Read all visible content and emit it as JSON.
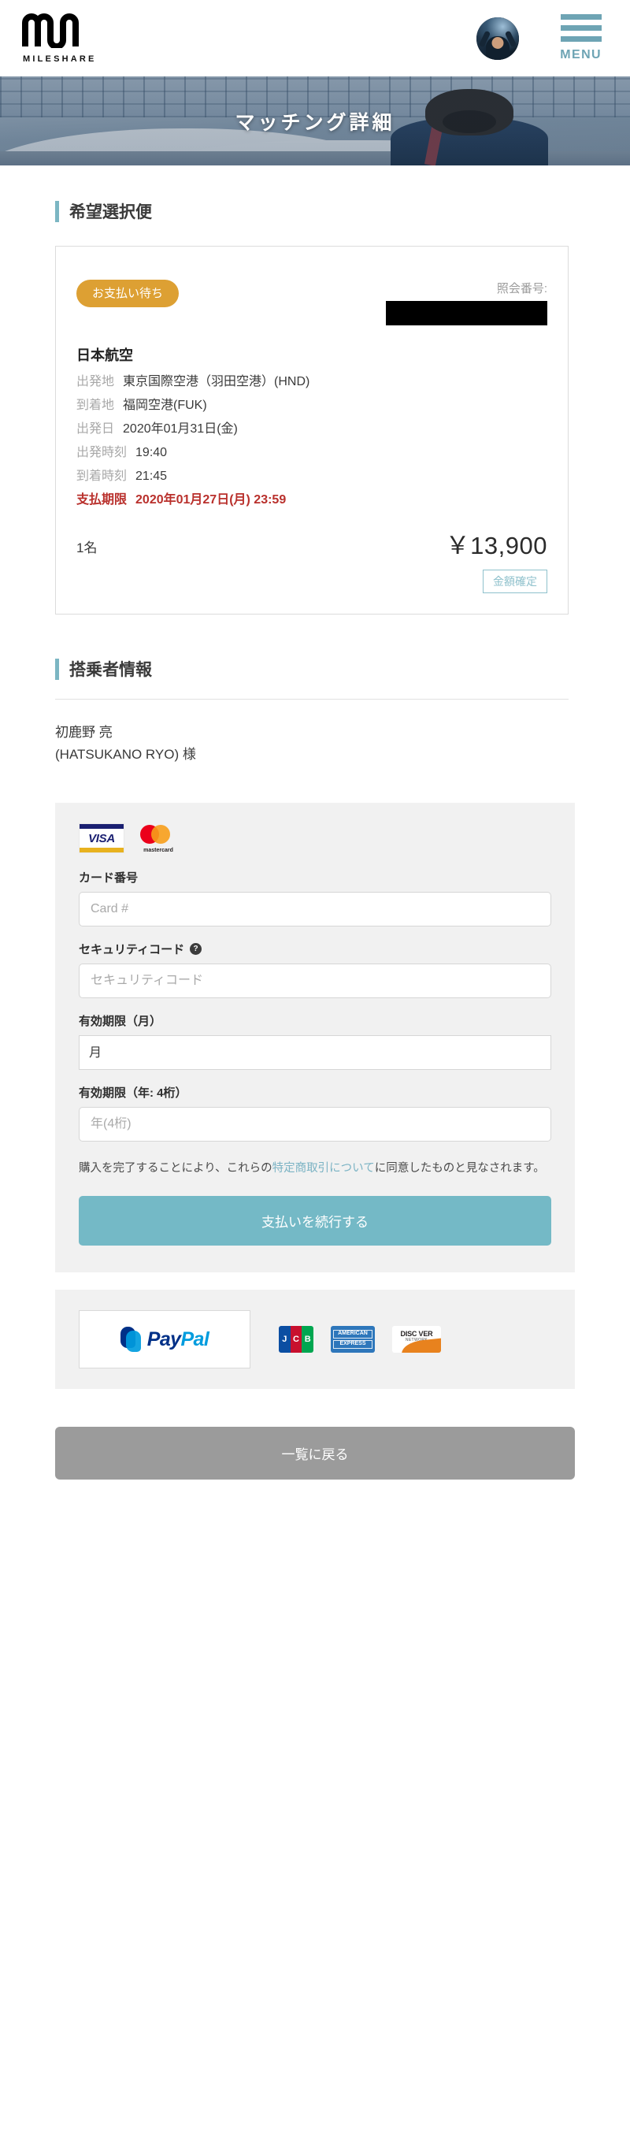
{
  "header": {
    "logo_word": "MILESHARE",
    "logo_icon": "mileshare-wave-logo",
    "avatar_icon": "user-avatar",
    "menu_label": "MENU",
    "menu_icon": "hamburger-menu-icon"
  },
  "hero": {
    "title": "マッチング詳細",
    "image_alt": "airport-flight-attendant"
  },
  "flight_section": {
    "title": "希望選択便",
    "status_badge": "お支払い待ち",
    "reference_label": "照会番号:",
    "reference_value": "",
    "airline": "日本航空",
    "details": [
      {
        "label": "出発地",
        "value": "東京国際空港（羽田空港）(HND)"
      },
      {
        "label": "到着地",
        "value": "福岡空港(FUK)"
      },
      {
        "label": "出発日",
        "value": "2020年01月31日(金)"
      },
      {
        "label": "出発時刻",
        "value": "19:40"
      },
      {
        "label": "到着時刻",
        "value": "21:45"
      }
    ],
    "deadline": {
      "label": "支払期限",
      "value": "2020年01月27日(月) 23:59"
    },
    "passenger_count": "1名",
    "price": "￥13,900",
    "price_confirm_label": "金額確定"
  },
  "passenger_section": {
    "title": "搭乗者情報",
    "name_ja": "初鹿野 亮",
    "name_en": "(HATSUKANO RYO) 様"
  },
  "payment_form": {
    "brands": [
      {
        "name": "visa-logo",
        "label": "VISA"
      },
      {
        "name": "mastercard-logo",
        "label": "mastercard"
      }
    ],
    "card_number_label": "カード番号",
    "card_number_placeholder": "Card #",
    "card_number_value": "",
    "security_code_label": "セキュリティコード",
    "security_code_help_icon": "question-mark-icon",
    "security_code_placeholder": "セキュリティコード",
    "security_code_value": "",
    "expiry_month_label": "有効期限（月）",
    "expiry_month_value": "月",
    "expiry_year_label": "有効期限（年: 4桁）",
    "expiry_year_placeholder": "年(4桁)",
    "expiry_year_value": "",
    "terms_prefix": "購入を完了することにより、これらの",
    "terms_link": "特定商取引について",
    "terms_suffix": "に同意したものと見なされます。",
    "submit_label": "支払いを続行する"
  },
  "paypal_section": {
    "paypal_label_a": "Pay",
    "paypal_label_b": "Pal",
    "paypal_icon": "paypal-logo",
    "alt_brands": [
      {
        "name": "jcb-logo",
        "p1": "J",
        "p2": "C",
        "p3": "B"
      },
      {
        "name": "amex-logo",
        "line1": "AMERICAN",
        "line2": "EXPRESS"
      },
      {
        "name": "discover-logo",
        "line1": "DISC VER",
        "line2": "NETWORK"
      }
    ]
  },
  "footer": {
    "back_label": "一覧に戻る"
  },
  "colors": {
    "accent_teal": "#74b9c6",
    "badge_gold": "#dda033",
    "deadline_red": "#b9302c",
    "panel_gray": "#f1f1f1",
    "back_gray": "#9b9b9b"
  }
}
